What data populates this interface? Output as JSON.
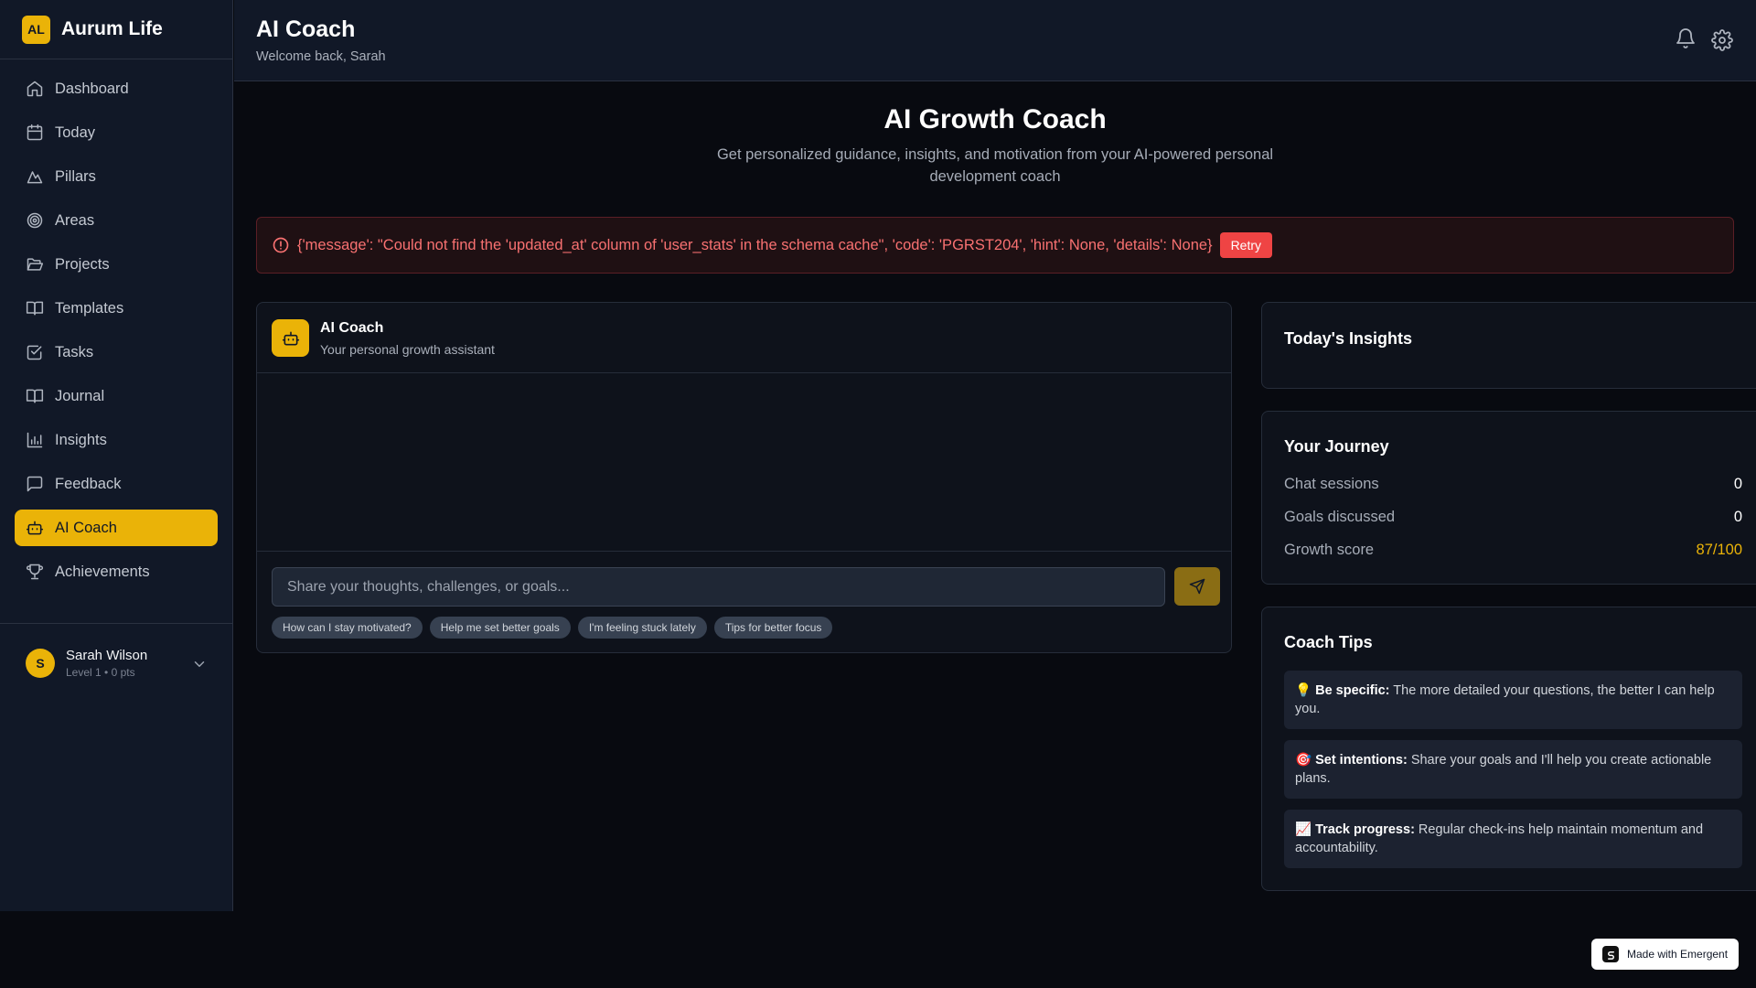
{
  "brand": {
    "logo_text": "AL",
    "name": "Aurum Life"
  },
  "sidebar": {
    "items": [
      {
        "label": "Dashboard",
        "icon": "home-icon"
      },
      {
        "label": "Today",
        "icon": "calendar-icon"
      },
      {
        "label": "Pillars",
        "icon": "mountain-icon"
      },
      {
        "label": "Areas",
        "icon": "target-icon"
      },
      {
        "label": "Projects",
        "icon": "folder-open-icon"
      },
      {
        "label": "Templates",
        "icon": "book-open-icon"
      },
      {
        "label": "Tasks",
        "icon": "check-square-icon"
      },
      {
        "label": "Journal",
        "icon": "book-icon"
      },
      {
        "label": "Insights",
        "icon": "bar-chart-icon"
      },
      {
        "label": "Feedback",
        "icon": "message-square-icon"
      },
      {
        "label": "AI Coach",
        "icon": "bot-icon",
        "active": true
      },
      {
        "label": "Achievements",
        "icon": "trophy-icon"
      }
    ],
    "user": {
      "initial": "S",
      "name": "Sarah Wilson",
      "level": "Level 1 • 0 pts"
    }
  },
  "header": {
    "title": "AI Coach",
    "subtitle": "Welcome back, Sarah",
    "icons": [
      "bell-icon",
      "gear-icon"
    ]
  },
  "main": {
    "title": "AI Growth Coach",
    "subtitle": "Get personalized guidance, insights, and motivation from your AI-powered personal development coach",
    "error": {
      "message": "{'message': \"Could not find the 'updated_at' column of 'user_stats' in the schema cache\", 'code': 'PGRST204', 'hint': None, 'details': None}",
      "retry_label": "Retry"
    },
    "chat": {
      "name": "AI Coach",
      "role": "Your personal growth assistant",
      "input_placeholder": "Share your thoughts, challenges, or goals...",
      "input_value": "",
      "suggestions": [
        "How can I stay motivated?",
        "Help me set better goals",
        "I'm feeling stuck lately",
        "Tips for better focus"
      ]
    }
  },
  "insights": {
    "title": "Today's Insights"
  },
  "journey": {
    "title": "Your Journey",
    "rows": [
      {
        "label": "Chat sessions",
        "value": "0"
      },
      {
        "label": "Goals discussed",
        "value": "0"
      },
      {
        "label": "Growth score",
        "value": "87/100"
      }
    ]
  },
  "tips": {
    "title": "Coach Tips",
    "items": [
      {
        "emoji": "💡",
        "lead": "Be specific:",
        "text": " The more detailed your questions, the better I can help you."
      },
      {
        "emoji": "🎯",
        "lead": "Set intentions:",
        "text": " Share your goals and I'll help you create actionable plans."
      },
      {
        "emoji": "📈",
        "lead": "Track progress:",
        "text": " Regular check-ins help maintain momentum and accountability."
      }
    ]
  },
  "badge": {
    "label": "Made with Emergent"
  },
  "colors": {
    "accent": "#eab308",
    "error": "#f87171",
    "retry": "#ef4444",
    "sidebar_bg": "#111827"
  }
}
